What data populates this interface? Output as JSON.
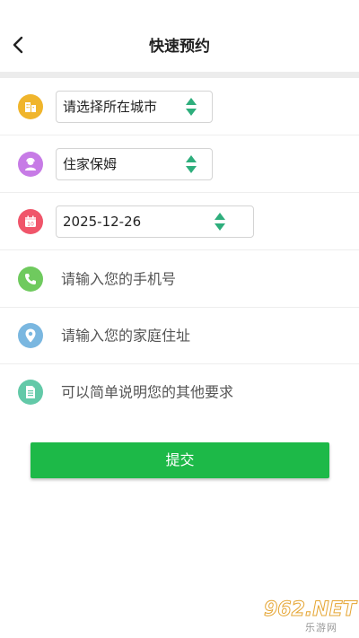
{
  "header": {
    "title": "快速预约"
  },
  "form": {
    "city": {
      "value": "请选择所在城市",
      "icon": "building-icon",
      "icon_color": "#f0b52c"
    },
    "service": {
      "value": "住家保姆",
      "icon": "nanny-icon",
      "icon_color": "#c77be6"
    },
    "date": {
      "value": "2025-12-26",
      "icon": "calendar-icon",
      "icon_color": "#f0556a"
    },
    "phone": {
      "placeholder": "请输入您的手机号",
      "icon": "phone-icon",
      "icon_color": "#6fca5e"
    },
    "address": {
      "placeholder": "请输入您的家庭住址",
      "icon": "location-icon",
      "icon_color": "#7ab7e0"
    },
    "note": {
      "placeholder": "可以简单说明您的其他要求",
      "icon": "document-icon",
      "icon_color": "#63c9a8"
    }
  },
  "submit_label": "提交",
  "watermark": {
    "brand": "962.NET",
    "sub": "乐游网"
  },
  "colors": {
    "accent": "#1db948",
    "spinner": "#2eae7c"
  }
}
